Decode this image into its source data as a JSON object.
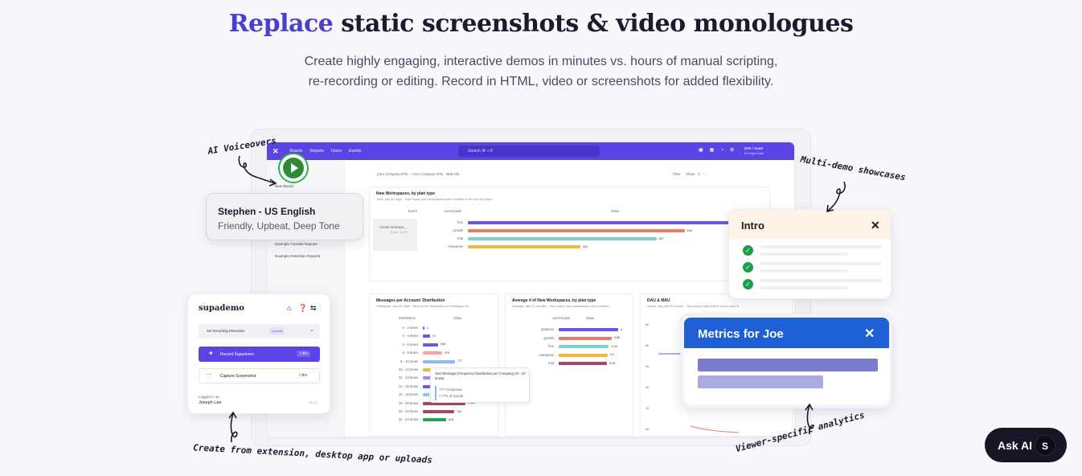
{
  "hero": {
    "title_highlight": "Replace",
    "title_rest": " static screenshots & video monologues",
    "subtitle": "Create highly engaging, interactive demos in minutes vs. hours of manual scripting, re-recording or editing. Record in HTML, video or screenshots for added flexibility."
  },
  "dashboard": {
    "nav": [
      "Boards",
      "Reports",
      "Users",
      "Events"
    ],
    "search_placeholder": "Search  ⌘ + K",
    "account": "B2B / SaaS",
    "account_sub": "AI Project Data",
    "sidebar": {
      "new_board": "New Board",
      "funnels": "Example Funnels Reports",
      "retention": "Example Retention Reports"
    },
    "breadcrumb": [
      "Core Company KPIs",
      "Core Company KPIs",
      "Web Info"
    ],
    "actions": [
      "Filter",
      "Share"
    ],
    "card_workspaces": {
      "title": "New Workspaces, by plan type",
      "subtitle": "Total, last 30 days · How many new workspaces were created in the last 30 days?",
      "col_event": "Event",
      "col_plan": "current plan",
      "col_value": "Value",
      "event_label": "Create Workspa...",
      "event_sub": "Event · 5,437",
      "rows": [
        {
          "label": "free",
          "value": "",
          "pct": 1.0,
          "color": "#6d55ea"
        },
        {
          "label": "growth",
          "value": "640",
          "pct": 0.77,
          "color": "#e97b67"
        },
        {
          "label": "trial",
          "value": "557",
          "pct": 0.67,
          "color": "#7fd3cf"
        },
        {
          "label": "enterprise",
          "value": "331",
          "pct": 0.4,
          "color": "#f0b83f"
        }
      ]
    },
    "card_messages": {
      "title": "Messages per Account: Distribution",
      "subtitle": "Histogram, last 30 days · What is the distribution of messages se...",
      "col_a": "Distribution",
      "col_b": "Value",
      "rows": [
        {
          "label": "0 - 2 times",
          "value": "1",
          "pct": 0.02,
          "color": "#6d55ea"
        },
        {
          "label": "2 - 4 times",
          "value": "74",
          "pct": 0.1,
          "color": "#6d55ea"
        },
        {
          "label": "4 - 6 times",
          "value": "248",
          "pct": 0.22,
          "color": "#6d55ea"
        },
        {
          "label": "6 - 8 times",
          "value": "379",
          "pct": 0.28,
          "color": "#f5a3a3"
        },
        {
          "label": "8 - 10 times",
          "value": "777",
          "pct": 0.47,
          "color": "#8fb8f0"
        },
        {
          "label": "10 - 12 times",
          "value": "",
          "pct": 0.12,
          "color": "#f0b83f"
        },
        {
          "label": "12 - 14 times",
          "value": "",
          "pct": 0.1,
          "color": "#9b8cf5"
        },
        {
          "label": "14 - 16 times",
          "value": "",
          "pct": 0.1,
          "color": "#6d55ea"
        },
        {
          "label": "16 - 18 times",
          "value": "",
          "pct": 0.09,
          "color": "#7fd3cf"
        },
        {
          "label": "18 - 20 times",
          "value": "1,866",
          "pct": 0.62,
          "color": "#a24a6a"
        },
        {
          "label": "20 - 22 times",
          "value": "762",
          "pct": 0.46,
          "color": "#a24a6a"
        },
        {
          "label": "22 - 24 times",
          "value": "615",
          "pct": 0.34,
          "color": "#2aa05a"
        }
      ],
      "tooltip_title": "Sent Message (Frequency Distribution per Company) (8 - 10 times)",
      "tooltip_companies": "777  Companies",
      "tooltip_pct": "7.77% of overall"
    },
    "card_avg": {
      "title": "Average # of New Workspaces, by plan type",
      "subtitle": "Average, last 12 months · How many new workspaces were created...",
      "col_a": "current plan",
      "col_b": "Value",
      "rows": [
        {
          "label": "platinum",
          "value": "4",
          "pct": 0.92,
          "color": "#6d55ea"
        },
        {
          "label": "growth",
          "value": "3.56",
          "pct": 0.82,
          "color": "#e97b67"
        },
        {
          "label": "free",
          "value": "3.33",
          "pct": 0.78,
          "color": "#7fd3cf"
        },
        {
          "label": "enterprise",
          "value": "3.3",
          "pct": 0.76,
          "color": "#f0b83f"
        },
        {
          "label": "trial",
          "value": "3.29",
          "pct": 0.75,
          "color": "#a24a6a"
        }
      ]
    },
    "card_dau": {
      "title": "DAU & MAU",
      "subtitle": "Linear, day, last 3 months · How many Daily Active Users sent m...",
      "ticks": [
        "8K",
        "6K",
        "4K",
        "2K",
        "1K",
        "0K"
      ]
    }
  },
  "voice_panel": {
    "name": "Stephen - US English",
    "traits": "Friendly, Upbeat, Deep Tone"
  },
  "supademo_panel": {
    "brand": "supademo",
    "dimension_label": "Set Recording Dimension",
    "dimension_badge": "Current",
    "record_label": "Record Supademo",
    "record_shortcut": "⇧⌘S",
    "capture_label": "Capture Screenshot",
    "capture_shortcut": "⇧⌘S",
    "logged_in_label": "Logged in as",
    "user": "Joseph Lee",
    "version": "v4.1.0"
  },
  "intro_panel": {
    "title": "Intro",
    "close": "✕"
  },
  "metrics_panel": {
    "title": "Metrics for Joe",
    "close": "✕"
  },
  "annotations": {
    "voiceovers": "AI Voiceovers",
    "multi_demo": "Multi-demo showcases",
    "create_from": "Create from extension, desktop app or uploads",
    "viewer_specific": "Viewer-specific analytics"
  },
  "ask_ai": {
    "label": "Ask AI",
    "avatar": "S"
  },
  "colors": {
    "accent": "#4a3fd0",
    "nav": "#5a44e6",
    "metrics_header": "#1e5fd6",
    "check": "#1e9e4a"
  }
}
